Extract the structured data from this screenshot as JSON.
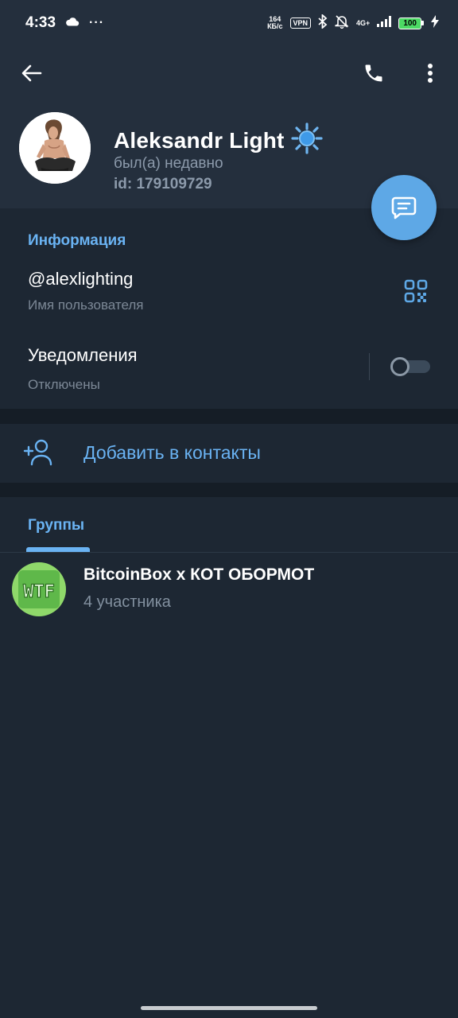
{
  "status_bar": {
    "time": "4:33",
    "more": "···",
    "net_speed_value": "164",
    "net_speed_unit": "КБ/с",
    "vpn": "VPN",
    "network": "4G+",
    "battery": "100"
  },
  "profile": {
    "name": "Aleksandr Light",
    "status": "был(а) недавно",
    "id_text": "id: 179109729",
    "avatar_icon": "person-photo",
    "emoji_icon": "sun-icon"
  },
  "info": {
    "section_title": "Информация",
    "username": "@alexlighting",
    "username_label": "Имя пользователя",
    "notifications_title": "Уведомления",
    "notifications_value": "Отключены",
    "notifications_enabled": false
  },
  "actions": {
    "add_contact_label": "Добавить в контакты"
  },
  "groups": {
    "tab_label": "Группы",
    "items": [
      {
        "name": "BitcoinBox x КОТ ОБОРМОТ",
        "members": "4 участника",
        "avatar_text": "WTF"
      }
    ]
  },
  "colors": {
    "accent": "#6ab3f3",
    "header_bg": "#242f3d",
    "page_bg": "#1d2733",
    "fab": "#5ea8e6"
  }
}
